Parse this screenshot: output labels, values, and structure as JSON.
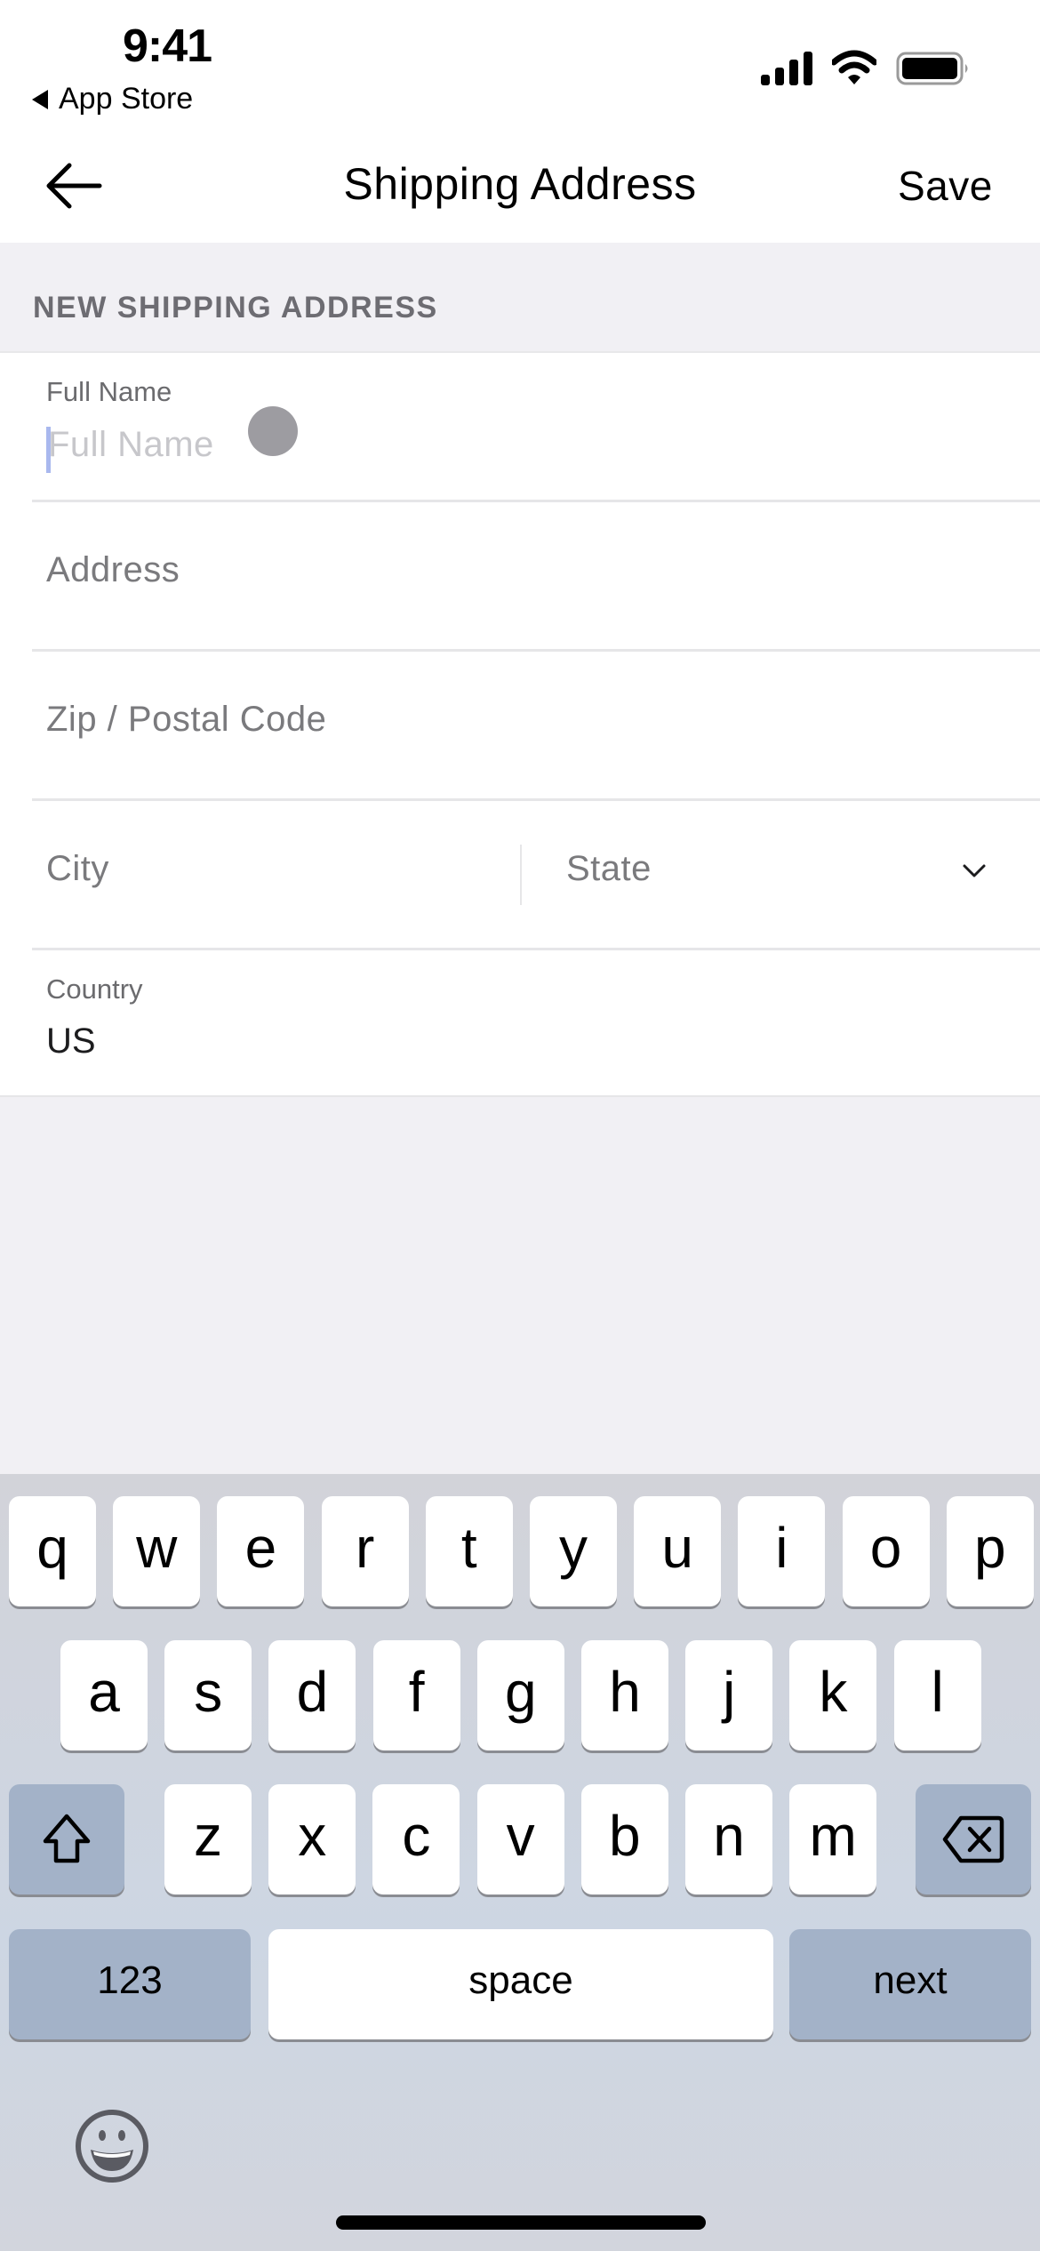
{
  "status_bar": {
    "time": "9:41",
    "back_app_label": "App Store",
    "icons": [
      "signal-icon",
      "wifi-icon",
      "battery-icon"
    ]
  },
  "nav": {
    "title": "Shipping Address",
    "back_icon": "arrow-left-icon",
    "save_label": "Save"
  },
  "section": {
    "header": "NEW SHIPPING ADDRESS"
  },
  "form": {
    "full_name": {
      "label": "Full Name",
      "placeholder": "Full Name",
      "value": ""
    },
    "address": {
      "placeholder": "Address",
      "value": ""
    },
    "zip": {
      "placeholder": "Zip / Postal Code",
      "value": ""
    },
    "city": {
      "placeholder": "City",
      "value": ""
    },
    "state": {
      "placeholder": "State",
      "value": "",
      "icon": "chevron-down-icon"
    },
    "country": {
      "label": "Country",
      "value": "US"
    }
  },
  "keyboard": {
    "row1": [
      "q",
      "w",
      "e",
      "r",
      "t",
      "y",
      "u",
      "i",
      "o",
      "p"
    ],
    "row2": [
      "a",
      "s",
      "d",
      "f",
      "g",
      "h",
      "j",
      "k",
      "l"
    ],
    "row3": [
      "z",
      "x",
      "c",
      "v",
      "b",
      "n",
      "m"
    ],
    "shift_icon": "shift-icon",
    "delete_icon": "backspace-icon",
    "numbers_label": "123",
    "space_label": "space",
    "return_label": "next",
    "emoji_icon": "emoji-icon"
  },
  "colors": {
    "caret": "#a9b8ee",
    "placeholder": "#7a7a7d",
    "section_header": "#6d6c72",
    "keyboard_fn_key": "#a3b2c8"
  }
}
